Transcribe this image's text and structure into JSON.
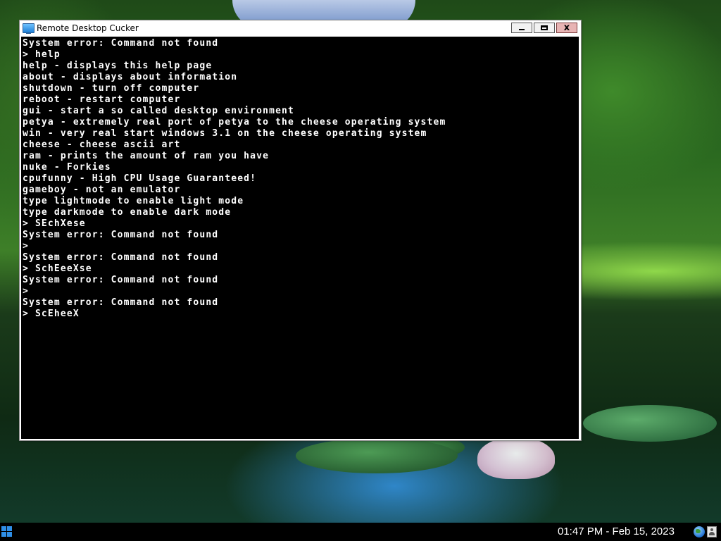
{
  "window": {
    "title": "Remote Desktop Cucker",
    "minimize_label": "",
    "maximize_label": "",
    "close_label": "x"
  },
  "terminal": {
    "lines": [
      "System error: Command not found",
      "> help",
      "help - displays this help page",
      "about - displays about information",
      "shutdown - turn off computer",
      "reboot - restart computer",
      "gui - start a so called desktop environment",
      "petya - extremely real port of petya to the cheese operating system",
      "win - very real start windows 3.1 on the cheese operating system",
      "cheese - cheese ascii art",
      "ram - prints the amount of ram you have",
      "nuke - Forkies",
      "cpufunny - High CPU Usage Guaranteed!",
      "gameboy - not an emulator",
      "type lightmode to enable light mode",
      "type darkmode to enable dark mode",
      "> SEchXese",
      "System error: Command not found",
      ">",
      "System error: Command not found",
      "> SchEeeXse",
      "System error: Command not found",
      ">",
      "System error: Command not found",
      "> ScEheeX"
    ]
  },
  "taskbar": {
    "clock": "01:47 PM - Feb 15, 2023",
    "start_icon": "windows-logo-icon",
    "tray_icons": [
      "globe-icon",
      "user-icon"
    ]
  },
  "colors": {
    "terminal_bg": "#000000",
    "terminal_fg": "#ffffff",
    "taskbar_bg": "#000000",
    "start_blue": "#2f8fe8"
  }
}
